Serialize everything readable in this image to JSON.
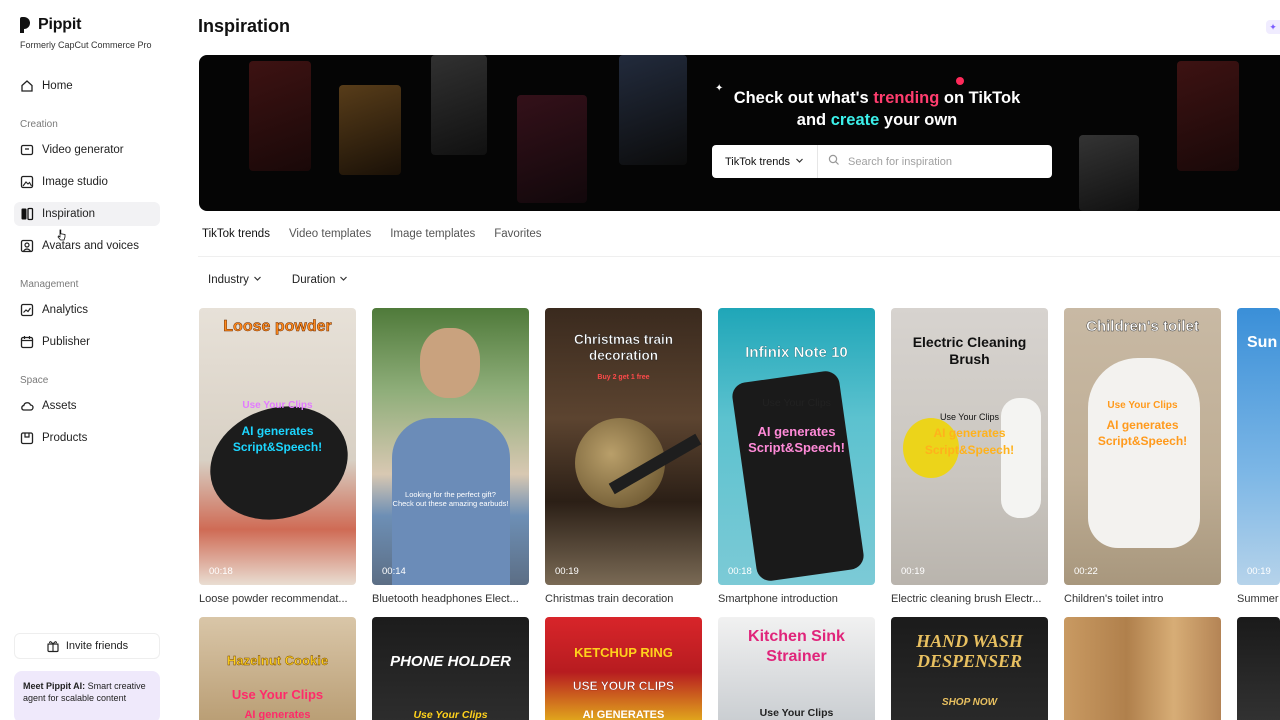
{
  "brand": {
    "name": "Pippit",
    "subtitle": "Formerly CapCut Commerce Pro"
  },
  "sidebar": {
    "home": "Home",
    "sections": {
      "creation": "Creation",
      "management": "Management",
      "space": "Space"
    },
    "items": [
      {
        "label": "Video generator",
        "icon": "video-icon"
      },
      {
        "label": "Image studio",
        "icon": "image-icon"
      },
      {
        "label": "Inspiration",
        "icon": "inspiration-icon",
        "active": true
      },
      {
        "label": "Avatars and voices",
        "icon": "avatar-icon"
      },
      {
        "label": "Analytics",
        "icon": "analytics-icon"
      },
      {
        "label": "Publisher",
        "icon": "calendar-icon"
      },
      {
        "label": "Assets",
        "icon": "cloud-icon"
      },
      {
        "label": "Products",
        "icon": "box-icon"
      }
    ],
    "invite": "Invite friends",
    "promo_bold": "Meet Pippit AI:",
    "promo_text": " Smart creative agent for scalable content"
  },
  "page": {
    "title": "Inspiration"
  },
  "hero": {
    "line1_a": "Check out what's ",
    "line1_b": "trending",
    "line1_c": " on TikTok",
    "line2_a": "and ",
    "line2_b": "create",
    "line2_c": " your own",
    "select_value": "TikTok trends",
    "search_placeholder": "Search for inspiration",
    "colors": {
      "trending": "#ff3d6e",
      "create": "#3cf0ea"
    }
  },
  "tabs": [
    "TikTok trends",
    "Video templates",
    "Image templates",
    "Favorites"
  ],
  "filters": [
    "Industry",
    "Duration"
  ],
  "cards": [
    {
      "title": "Loose powder",
      "overlay1": "Use Your Clips",
      "overlay2": "AI generates",
      "overlay3": "Script&Speech!",
      "duration": "00:18",
      "caption": "Loose powder recommendat..."
    },
    {
      "title": "",
      "overlay1": "Looking for the perfect gift?",
      "overlay2": "Check out these amazing earbuds!",
      "overlay3": "",
      "duration": "00:14",
      "caption": "Bluetooth headphones Elect..."
    },
    {
      "title": "Christmas train decoration",
      "overlay1": "Buy 2 get 1 free",
      "overlay2": "",
      "overlay3": "",
      "duration": "00:19",
      "caption": "Christmas train decoration"
    },
    {
      "title": "Infinix Note 10",
      "overlay1": "Use Your Clips",
      "overlay2": "AI generates",
      "overlay3": "Script&Speech!",
      "duration": "00:18",
      "caption": "Smartphone introduction"
    },
    {
      "title": "Electric Cleaning Brush",
      "overlay1": "Use Your Clips",
      "overlay2": "AI generates",
      "overlay3": "Script&Speech!",
      "duration": "00:19",
      "caption": "Electric cleaning brush Electr..."
    },
    {
      "title": "Children's toilet",
      "overlay1": "Use Your Clips",
      "overlay2": "AI generates",
      "overlay3": "Script&Speech!",
      "duration": "00:22",
      "caption": "Children's toilet intro"
    },
    {
      "title": "Sun",
      "overlay1": "",
      "overlay2": "",
      "overlay3": "",
      "duration": "00:19",
      "caption": "Summer"
    }
  ],
  "row2": [
    {
      "title": "Hazelnut Cookie",
      "sub": "Use Your Clips",
      "sub2": "AI generates"
    },
    {
      "title": "PHONE HOLDER",
      "sub": "Use Your Clips",
      "sub2": ""
    },
    {
      "title": "KETCHUP RING",
      "sub": "USE YOUR CLIPS",
      "sub2": "AI GENERATES"
    },
    {
      "title": "Kitchen Sink Strainer",
      "sub": "Use Your Clips",
      "sub2": ""
    },
    {
      "title": "HAND WASH DESPENSER",
      "sub": "SHOP NOW",
      "sub2": ""
    },
    {
      "title": "",
      "sub": "",
      "sub2": ""
    },
    {
      "title": "",
      "sub": "",
      "sub2": ""
    }
  ]
}
